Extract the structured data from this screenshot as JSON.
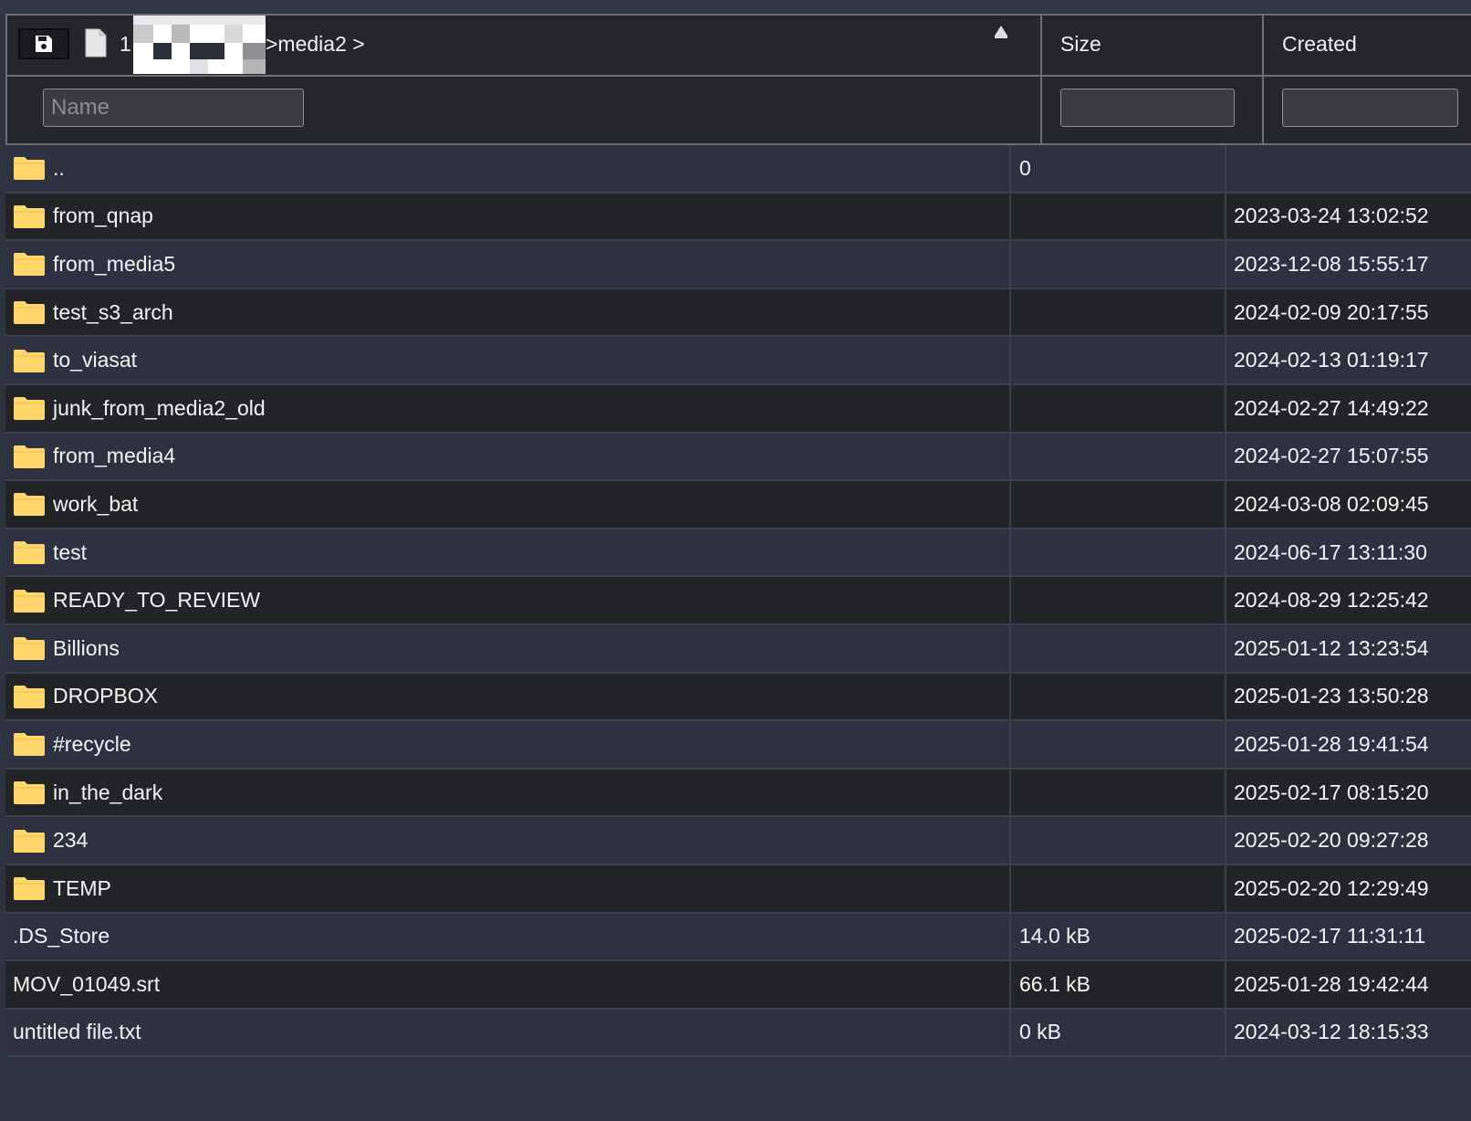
{
  "header": {
    "breadcrumb_prefix": "1",
    "breadcrumb_path": ">media2 >",
    "size_label": "Size",
    "created_label": "Created"
  },
  "filters": {
    "name_placeholder": "Name",
    "size_value": "",
    "created_value": ""
  },
  "rows": [
    {
      "name": "..",
      "size": "0",
      "created": "",
      "type": "folder"
    },
    {
      "name": "from_qnap",
      "size": "",
      "created": "2023-03-24 13:02:52",
      "type": "folder"
    },
    {
      "name": "from_media5",
      "size": "",
      "created": "2023-12-08 15:55:17",
      "type": "folder"
    },
    {
      "name": "test_s3_arch",
      "size": "",
      "created": "2024-02-09 20:17:55",
      "type": "folder"
    },
    {
      "name": "to_viasat",
      "size": "",
      "created": "2024-02-13 01:19:17",
      "type": "folder"
    },
    {
      "name": "junk_from_media2_old",
      "size": "",
      "created": "2024-02-27 14:49:22",
      "type": "folder"
    },
    {
      "name": "from_media4",
      "size": "",
      "created": "2024-02-27 15:07:55",
      "type": "folder"
    },
    {
      "name": "work_bat",
      "size": "",
      "created": "2024-03-08 02:09:45",
      "type": "folder"
    },
    {
      "name": "test",
      "size": "",
      "created": "2024-06-17 13:11:30",
      "type": "folder"
    },
    {
      "name": "READY_TO_REVIEW",
      "size": "",
      "created": "2024-08-29 12:25:42",
      "type": "folder"
    },
    {
      "name": "Billions",
      "size": "",
      "created": "2025-01-12 13:23:54",
      "type": "folder"
    },
    {
      "name": "DROPBOX",
      "size": "",
      "created": "2025-01-23 13:50:28",
      "type": "folder"
    },
    {
      "name": "#recycle",
      "size": "",
      "created": "2025-01-28 19:41:54",
      "type": "folder"
    },
    {
      "name": "in_the_dark",
      "size": "",
      "created": "2025-02-17 08:15:20",
      "type": "folder"
    },
    {
      "name": "234",
      "size": "",
      "created": "2025-02-20 09:27:28",
      "type": "folder"
    },
    {
      "name": "TEMP",
      "size": "",
      "created": "2025-02-20 12:29:49",
      "type": "folder"
    },
    {
      "name": ".DS_Store",
      "size": "14.0 kB",
      "created": "2025-02-17 11:31:11",
      "type": "file"
    },
    {
      "name": "MOV_01049.srt",
      "size": "66.1 kB",
      "created": "2025-01-28 19:42:44",
      "type": "file"
    },
    {
      "name": "untitled file.txt",
      "size": "0 kB",
      "created": "2024-03-12 18:15:33",
      "type": "file"
    }
  ],
  "icons": {
    "save": "save-icon",
    "document": "document-icon",
    "sort": "sort-up-icon",
    "folder": "folder-icon"
  },
  "colors": {
    "folder": "#ffd66b",
    "row_odd": "#2e3240",
    "row_even": "#232427"
  }
}
